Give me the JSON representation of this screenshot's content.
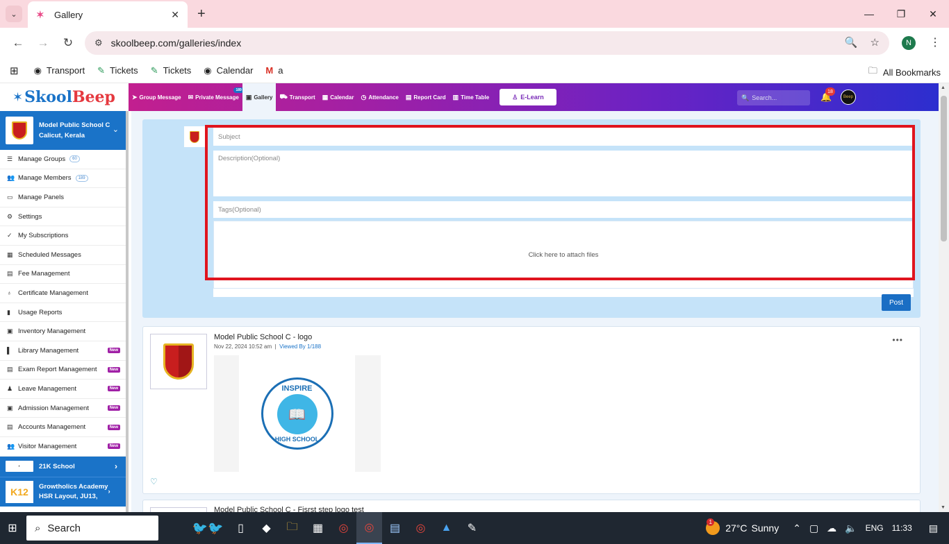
{
  "browser": {
    "tab_title": "Gallery",
    "url": "skoolbeep.com/galleries/index",
    "profile_initial": "N",
    "bookmarks": [
      {
        "icon": "globe-icon",
        "label": "Transport"
      },
      {
        "icon": "ticket-icon",
        "label": "Tickets"
      },
      {
        "icon": "ticket-icon",
        "label": "Tickets"
      },
      {
        "icon": "globe-icon",
        "label": "Calendar"
      },
      {
        "icon": "gmail-icon",
        "label": "a"
      }
    ],
    "all_bookmarks": "All Bookmarks"
  },
  "app": {
    "logo_skool": "Skool",
    "logo_beep": "Beep",
    "nav": [
      {
        "label": "Group Message",
        "icon": "send-icon"
      },
      {
        "label": "Private Message",
        "icon": "envelope-icon",
        "badge": "189"
      },
      {
        "label": "Gallery",
        "icon": "image-icon",
        "active": true
      },
      {
        "label": "Transport",
        "icon": "bus-icon"
      },
      {
        "label": "Calendar",
        "icon": "calendar-icon"
      },
      {
        "label": "Attendance",
        "icon": "clock-icon"
      },
      {
        "label": "Report Card",
        "icon": "report-icon"
      },
      {
        "label": "Time Table",
        "icon": "timetable-icon"
      }
    ],
    "elearn": "E-Learn",
    "search_placeholder": "Search...",
    "notification_count": "18",
    "avatar_text": "Beep"
  },
  "sidebar": {
    "school_name": "Model Public School C",
    "school_location": "Calicut, Kerala",
    "items": [
      {
        "label": "Manage Groups",
        "icon": "list-icon",
        "count": "60"
      },
      {
        "label": "Manage Members",
        "icon": "users-icon",
        "count": "189"
      },
      {
        "label": "Manage Panels",
        "icon": "monitor-icon"
      },
      {
        "label": "Settings",
        "icon": "gear-icon"
      },
      {
        "label": "My Subscriptions",
        "icon": "check-icon"
      },
      {
        "label": "Scheduled Messages",
        "icon": "calendar-icon"
      },
      {
        "label": "Fee Management",
        "icon": "file-icon"
      },
      {
        "label": "Certificate Management",
        "icon": "award-icon"
      },
      {
        "label": "Usage Reports",
        "icon": "bar-chart-icon"
      },
      {
        "label": "Inventory Management",
        "icon": "box-icon"
      },
      {
        "label": "Library Management",
        "icon": "book-icon",
        "new": "New"
      },
      {
        "label": "Exam Report Management",
        "icon": "file-icon",
        "new": "New"
      },
      {
        "label": "Leave Management",
        "icon": "user-minus-icon",
        "new": "New"
      },
      {
        "label": "Admission Management",
        "icon": "id-card-icon",
        "new": "New"
      },
      {
        "label": "Accounts Management",
        "icon": "file-icon",
        "new": "New"
      },
      {
        "label": "Visitor Management",
        "icon": "users-icon",
        "new": "New"
      }
    ],
    "other_schools": [
      {
        "name": "21K School"
      },
      {
        "name": "Growtholics Academy",
        "location": "HSR Layout, JU13,"
      }
    ]
  },
  "composer": {
    "subject_placeholder": "Subject",
    "description_placeholder": "Description(Optional)",
    "tags_placeholder": "Tags(Optional)",
    "attach_text": "Click here to attach files",
    "post_label": "Post"
  },
  "posts": [
    {
      "title": "Model Public School C - logo",
      "date": "Nov 22, 2024 10:52 am",
      "viewed": "Viewed By 1/188",
      "image_text_top": "INSPIRE",
      "image_text_bottom": "HIGH SCHOOL"
    },
    {
      "title": "Model Public School C - Fisrst step logo test"
    }
  ],
  "taskbar": {
    "search_label": "Search",
    "temperature": "27°C",
    "weather": "Sunny",
    "weather_badge": "1",
    "language": "ENG",
    "time": "11:33"
  }
}
